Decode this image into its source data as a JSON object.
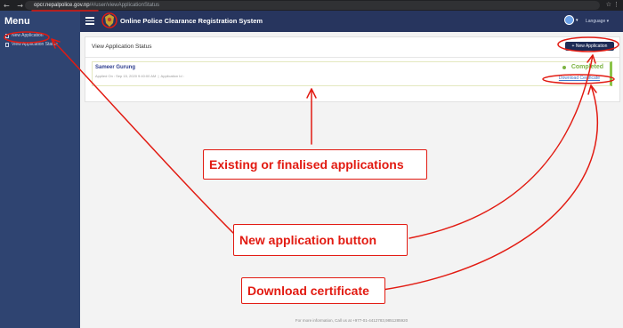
{
  "browser": {
    "nav_glyphs": "← → ↻",
    "url_host": "opcr.nepalpolice.gov.np",
    "url_path": "/#/user/viewApplicationStatus",
    "right_glyphs": "☆ ⋮"
  },
  "sidebar": {
    "title": "Menu",
    "items": [
      {
        "label": "New Application"
      },
      {
        "label": "View Application Status"
      }
    ]
  },
  "header": {
    "title": "Online Police Clearance Registration System",
    "language_label": "Language"
  },
  "main": {
    "card_title": "View Application Status",
    "new_button_label": "+ New Application",
    "application": {
      "name": "Sameer Gurung",
      "applied_on": "Applied On : Sep 15, 2020 9:40:00 AM",
      "application_id": "Application Id :",
      "status": "Completed",
      "download_label": "Download Certificate"
    }
  },
  "footer": {
    "text": "For more information, Call us at +977-01-4412783,9851285920"
  },
  "annotations": {
    "existing": "Existing or finalised applications",
    "new_button": "New application button",
    "download": "Download certificate"
  },
  "colors": {
    "sidebar": "#2f4471",
    "topbar": "#27355e",
    "annotation": "#e21b12",
    "status": "#7cb342"
  }
}
